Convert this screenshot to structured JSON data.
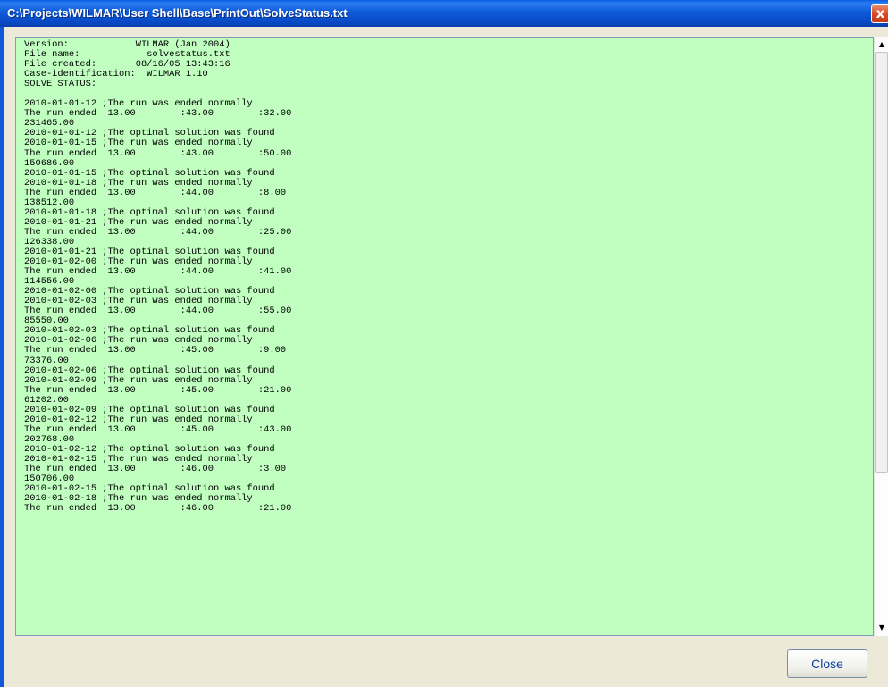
{
  "window": {
    "title": "C:\\Projects\\WILMAR\\User Shell\\Base\\PrintOut\\SolveStatus.txt",
    "close_glyph": "x"
  },
  "file_content": {
    "text": "Version:            WILMAR (Jan 2004)\nFile name:            solvestatus.txt\nFile created:       08/16/05 13:43:16\nCase-identification:  WILMAR 1.10\nSOLVE STATUS:\n\n2010-01-01-12 ;The run was ended normally\nThe run ended  13.00        :43.00        :32.00\n231465.00\n2010-01-01-12 ;The optimal solution was found\n2010-01-01-15 ;The run was ended normally\nThe run ended  13.00        :43.00        :50.00\n150686.00\n2010-01-01-15 ;The optimal solution was found\n2010-01-01-18 ;The run was ended normally\nThe run ended  13.00        :44.00        :8.00\n138512.00\n2010-01-01-18 ;The optimal solution was found\n2010-01-01-21 ;The run was ended normally\nThe run ended  13.00        :44.00        :25.00\n126338.00\n2010-01-01-21 ;The optimal solution was found\n2010-01-02-00 ;The run was ended normally\nThe run ended  13.00        :44.00        :41.00\n114556.00\n2010-01-02-00 ;The optimal solution was found\n2010-01-02-03 ;The run was ended normally\nThe run ended  13.00        :44.00        :55.00\n85550.00\n2010-01-02-03 ;The optimal solution was found\n2010-01-02-06 ;The run was ended normally\nThe run ended  13.00        :45.00        :9.00\n73376.00\n2010-01-02-06 ;The optimal solution was found\n2010-01-02-09 ;The run was ended normally\nThe run ended  13.00        :45.00        :21.00\n61202.00\n2010-01-02-09 ;The optimal solution was found\n2010-01-02-12 ;The run was ended normally\nThe run ended  13.00        :45.00        :43.00\n202768.00\n2010-01-02-12 ;The optimal solution was found\n2010-01-02-15 ;The run was ended normally\nThe run ended  13.00        :46.00        :3.00\n150706.00\n2010-01-02-15 ;The optimal solution was found\n2010-01-02-18 ;The run was ended normally\nThe run ended  13.00        :46.00        :21.00"
  },
  "scrollbar": {
    "up_glyph": "▲",
    "down_glyph": "▼"
  },
  "buttons": {
    "close_label": "Close"
  },
  "colors": {
    "text_background": "#c0ffc0",
    "titlebar": "#0e5ad8"
  }
}
